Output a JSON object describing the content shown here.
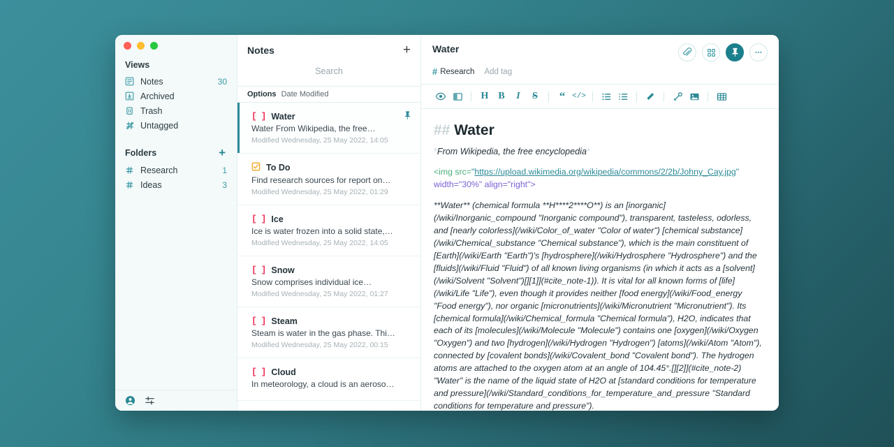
{
  "sidebar": {
    "views_header": "Views",
    "views": [
      {
        "icon": "notes-icon",
        "label": "Notes",
        "count": "30"
      },
      {
        "icon": "archive-icon",
        "label": "Archived",
        "count": ""
      },
      {
        "icon": "trash-icon",
        "label": "Trash",
        "count": ""
      },
      {
        "icon": "untagged-icon",
        "label": "Untagged",
        "count": ""
      }
    ],
    "folders_header": "Folders",
    "folders_add": "+",
    "folders": [
      {
        "icon": "hash-icon",
        "label": "Research",
        "count": "1"
      },
      {
        "icon": "hash-icon",
        "label": "Ideas",
        "count": "3"
      }
    ],
    "footer": {
      "account_icon": "account-icon",
      "settings_icon": "sliders-icon"
    }
  },
  "notelist": {
    "title": "Notes",
    "add_label": "+",
    "search_placeholder": "Search",
    "search_value": "",
    "options_label": "Options",
    "sort_value": "Date Modified",
    "notes": [
      {
        "checkbox": "[ ]",
        "state": "todo",
        "title": "Water",
        "excerpt": "Water From Wikipedia, the free…",
        "modified": "Modified Wednesday, 25 May 2022, 14:05",
        "pinned": true,
        "selected": true
      },
      {
        "checkbox": "☑",
        "state": "done",
        "title": "To Do",
        "excerpt": "Find research sources for report on…",
        "modified": "Modified Wednesday, 25 May 2022, 01:29",
        "pinned": false,
        "selected": false
      },
      {
        "checkbox": "[ ]",
        "state": "todo",
        "title": "Ice",
        "excerpt": "Ice is water frozen into a solid state,…",
        "modified": "Modified Wednesday, 25 May 2022, 14:05",
        "pinned": false,
        "selected": false
      },
      {
        "checkbox": "[ ]",
        "state": "todo",
        "title": "Snow",
        "excerpt": "Snow comprises individual ice…",
        "modified": "Modified Wednesday, 25 May 2022, 01:27",
        "pinned": false,
        "selected": false
      },
      {
        "checkbox": "[ ]",
        "state": "todo",
        "title": "Steam",
        "excerpt": "Steam is water in the gas phase. Thi…",
        "modified": "Modified Wednesday, 25 May 2022, 00:15",
        "pinned": false,
        "selected": false
      },
      {
        "checkbox": "[ ]",
        "state": "todo",
        "title": "Cloud",
        "excerpt": "In meteorology, a cloud is an aeroso…",
        "modified": "",
        "pinned": false,
        "selected": false
      }
    ]
  },
  "editor": {
    "title": "Water",
    "tag": "Research",
    "tag_hash": "#",
    "add_tag": "Add tag",
    "actions": [
      {
        "name": "attachment-icon",
        "glyph": "paperclip",
        "active": false
      },
      {
        "name": "grid-view-icon",
        "glyph": "grid",
        "active": false
      },
      {
        "name": "pin-icon",
        "glyph": "pin",
        "active": true
      },
      {
        "name": "more-options-icon",
        "glyph": "dots",
        "active": false
      }
    ],
    "toolbar": [
      {
        "name": "preview-icon",
        "glyph": "eye",
        "kind": "svg"
      },
      {
        "name": "split-view-icon",
        "glyph": "split",
        "kind": "svg"
      },
      {
        "name": "sep",
        "glyph": "",
        "kind": "sep"
      },
      {
        "name": "heading-button",
        "glyph": "H",
        "kind": "serif"
      },
      {
        "name": "bold-button",
        "glyph": "B",
        "kind": "serif"
      },
      {
        "name": "italic-button",
        "glyph": "I",
        "kind": "italic"
      },
      {
        "name": "strikethrough-button",
        "glyph": "S",
        "kind": "strike"
      },
      {
        "name": "sep",
        "glyph": "",
        "kind": "sep"
      },
      {
        "name": "blockquote-button",
        "glyph": "“",
        "kind": "quote"
      },
      {
        "name": "code-button",
        "glyph": "</>",
        "kind": "code"
      },
      {
        "name": "sep",
        "glyph": "",
        "kind": "sep"
      },
      {
        "name": "bullet-list-button",
        "glyph": "ul",
        "kind": "svg"
      },
      {
        "name": "ordered-list-button",
        "glyph": "ol",
        "kind": "svg"
      },
      {
        "name": "sep",
        "glyph": "",
        "kind": "sep"
      },
      {
        "name": "highlight-icon",
        "glyph": "marker",
        "kind": "svg"
      },
      {
        "name": "sep",
        "glyph": "",
        "kind": "sep"
      },
      {
        "name": "link-icon",
        "glyph": "link",
        "kind": "svg"
      },
      {
        "name": "image-icon",
        "glyph": "image",
        "kind": "svg"
      },
      {
        "name": "sep",
        "glyph": "",
        "kind": "sep"
      },
      {
        "name": "table-icon",
        "glyph": "table",
        "kind": "svg"
      }
    ],
    "content": {
      "h2_marker": "## ",
      "h2_text": "Water",
      "subtitle_marker": "*",
      "subtitle": "From Wikipedia, the free encyclopedia",
      "img_tag_open": "<img src=",
      "img_quote": "\"",
      "img_url": "https://upload.wikimedia.org/wikipedia/commons/2/2b/Johny_Cay.jpg",
      "img_attrs": " width=\"30%\" align=\"right\">",
      "body": "**Water** (chemical formula **H****2****O**) is an [inorganic](/wiki/Inorganic_compound \"Inorganic compound\"), transparent, tasteless, odorless, and [nearly colorless](/wiki/Color_of_water \"Color of water\") [chemical substance](/wiki/Chemical_substance \"Chemical substance\"), which is the main constituent of [Earth](/wiki/Earth \"Earth\")'s [hydrosphere](/wiki/Hydrosphere \"Hydrosphere\") and the [fluids](/wiki/Fluid \"Fluid\") of all known living organisms (in which it acts as a [solvent](/wiki/Solvent \"Solvent\")[][1]](#cite_note-1)). It is vital for all known forms of [life](/wiki/Life \"Life\"), even though it provides neither [food energy](/wiki/Food_energy \"Food energy\"), nor organic [micronutrients](/wiki/Micronutrient \"Micronutrient\"). Its [chemical formula](/wiki/Chemical_formula \"Chemical formula\"), H2O, indicates that each of its [molecules](/wiki/Molecule \"Molecule\") contains one [oxygen](/wiki/Oxygen \"Oxygen\") and two [hydrogen](/wiki/Hydrogen \"Hydrogen\") [atoms](/wiki/Atom \"Atom\"), connected by [covalent bonds](/wiki/Covalent_bond \"Covalent bond\"). The hydrogen atoms are attached to the oxygen atom at an angle of 104.45°.[][2]](#cite_note-2) \"Water\" is the name of the liquid state of H2O at [standard conditions for temperature and pressure](/wiki/Standard_conditions_for_temperature_and_pressure \"Standard conditions for temperature and pressure\")."
    }
  }
}
